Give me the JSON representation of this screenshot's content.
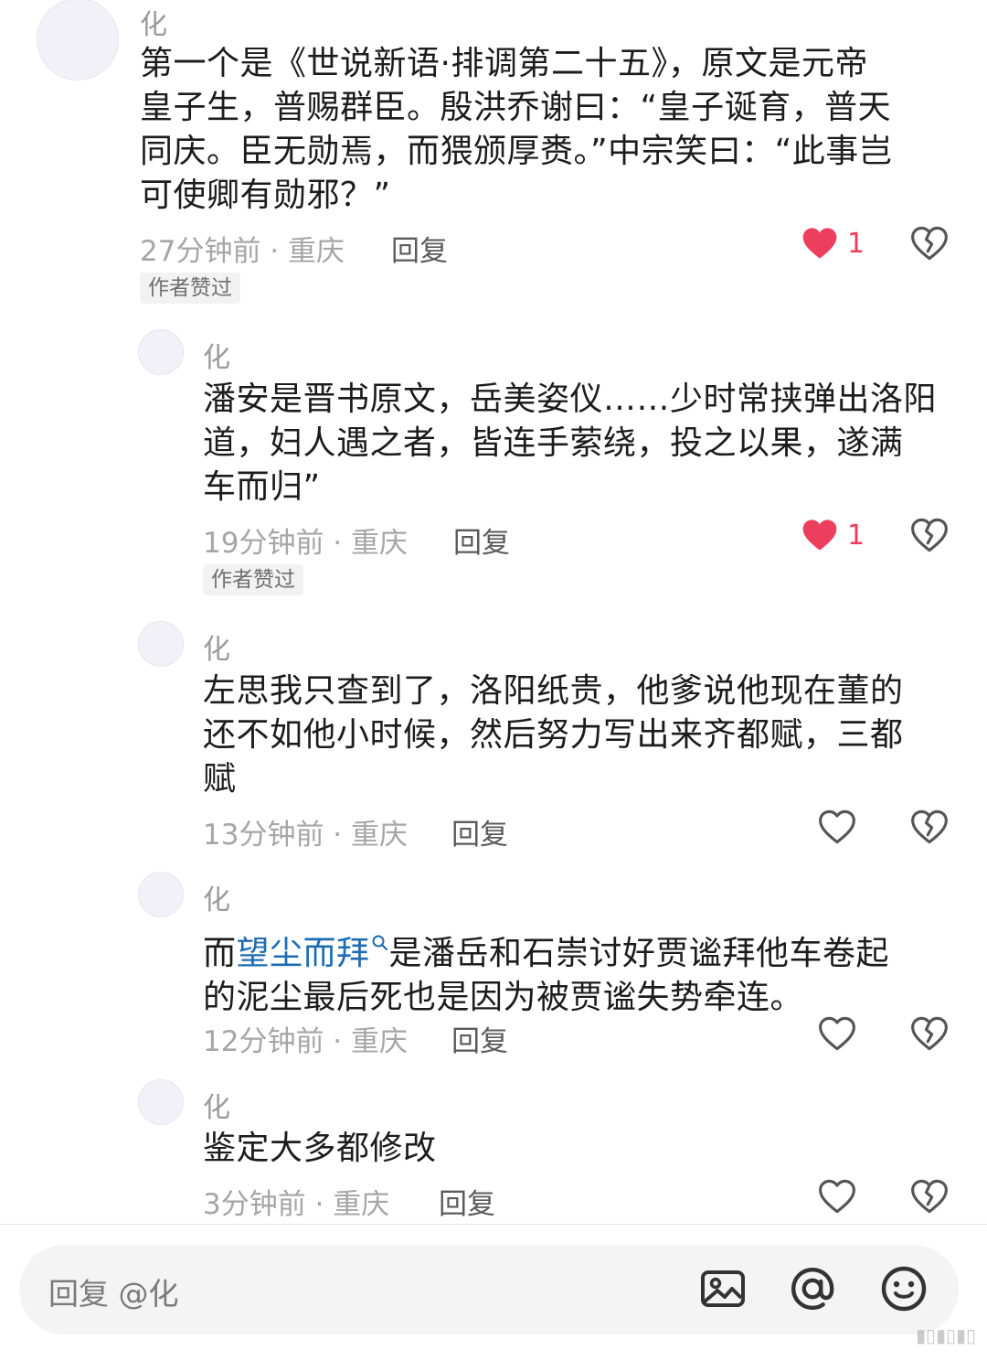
{
  "comments": [
    {
      "username": "化",
      "text_lines": [
        "第一个是《世说新语·排调第二十五》，原文是元帝",
        "皇子生，普赐群臣。殷洪乔谢曰：“皇子诞育，普天",
        "同庆。臣无勋焉，而猥颁厚赉。”中宗笑曰：“此事岂",
        "可使卿有勋邪？”"
      ],
      "meta": "27分钟前 · 重庆",
      "reply_label": "回复",
      "like_count": "1",
      "liked": true,
      "badge": "作者赞过"
    },
    {
      "username": "化",
      "text_lines": [
        "潘安是晋书原文，岳美姿仪……少时常挟弹出洛阳",
        "道，妇人遇之者，皆连手萦绕，投之以果，遂满",
        "车而归”"
      ],
      "meta": "19分钟前 · 重庆",
      "reply_label": "回复",
      "like_count": "1",
      "liked": true,
      "badge": "作者赞过"
    },
    {
      "username": "化",
      "text_lines": [
        "左思我只查到了，洛阳纸贵，他爹说他现在董的",
        "还不如他小时候，然后努力写出来齐都赋，三都",
        "赋"
      ],
      "meta": "13分钟前 · 重庆",
      "reply_label": "回复",
      "liked": false
    },
    {
      "username": "化",
      "text_before_link": "而",
      "link_text": "望尘而拜",
      "text_after_link": "是潘岳和石崇讨好贾谧拜他车卷起",
      "text_line2": "的泥尘最后死也是因为被贾谧失势牵连。",
      "meta": "12分钟前 · 重庆",
      "reply_label": "回复",
      "liked": false
    },
    {
      "username": "化",
      "text_lines": [
        "鉴定大多都修改"
      ],
      "meta": "3分钟前 · 重庆",
      "reply_label": "回复",
      "liked": false
    }
  ],
  "composer": {
    "placeholder": "回复 @化"
  },
  "icons": {
    "like_filled": "heart-filled-icon",
    "like_outline": "heart-outline-icon",
    "dislike": "broken-heart-icon",
    "image": "image-icon",
    "mention": "at-icon",
    "emoji": "smiley-icon",
    "link_search": "search-icon"
  },
  "colors": {
    "like": "#ee3e5d",
    "link": "#1e6cb3",
    "text": "#1c1c1c",
    "meta": "#a6a6a6"
  }
}
